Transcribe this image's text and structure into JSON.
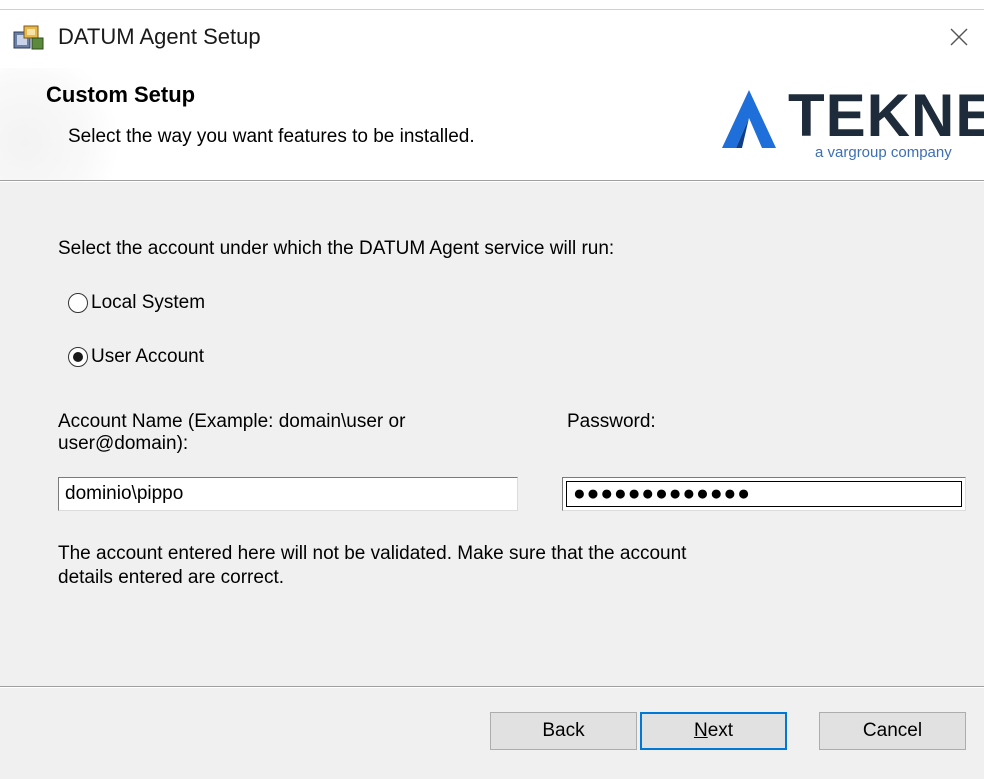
{
  "window": {
    "title": "DATUM Agent Setup",
    "icon": "installer-icon",
    "close_icon": "close-icon"
  },
  "banner": {
    "title": "Custom Setup",
    "subtitle": "Select the way you want features to be installed.",
    "logo": {
      "wordmark": "TEKNE",
      "tagline": "a vargroup company",
      "colors": {
        "mark": "#1e6fd9",
        "wordmark": "#1d2b3a",
        "tagline": "#3d6fb6"
      }
    }
  },
  "content": {
    "prompt": "Select the account under which the DATUM Agent service will run:",
    "options": [
      {
        "label": "Local System",
        "selected": false
      },
      {
        "label": "User Account",
        "selected": true
      }
    ],
    "account_label": "Account Name (Example: domain\\user or user@domain):",
    "account_value": "dominio\\pippo",
    "password_label": "Password:",
    "password_value": "●●●●●●●●●●●●●",
    "note": "The account entered here will not be validated. Make sure that the account details entered are correct."
  },
  "footer": {
    "back_label": "Back",
    "next_label_mnemonic": "N",
    "next_label_rest": "ext",
    "cancel_label": "Cancel",
    "accent_color": "#0078d7"
  }
}
